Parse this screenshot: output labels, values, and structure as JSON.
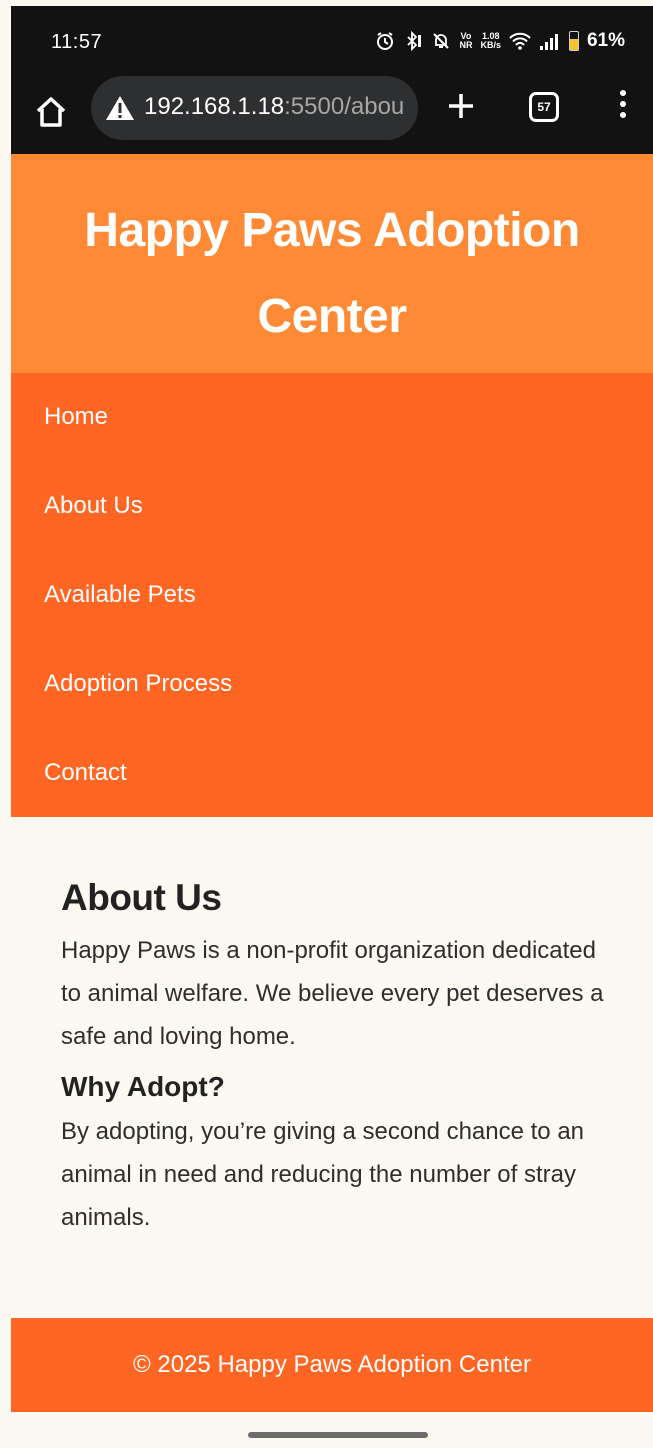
{
  "status_bar": {
    "time": "11:57",
    "network_speed_value": "1.08",
    "network_speed_unit": "KB/s",
    "network_type_top": "Vo",
    "network_type_bottom": "NR",
    "battery_percent": "61%",
    "battery_level": 0.61,
    "icons": [
      "alarm-icon",
      "bluetooth-icon",
      "mute-icon",
      "volte-icon",
      "wifi-icon",
      "signal-icon",
      "battery-icon"
    ]
  },
  "browser": {
    "url_host": "192.168.1.18",
    "url_rest": ":5500/abou",
    "tab_count": "57",
    "icons": [
      "home-icon",
      "not-secure-warning-icon",
      "new-tab-plus-icon",
      "tab-switcher-icon",
      "overflow-menu-icon"
    ]
  },
  "header": {
    "title": "Happy Paws Adoption Center"
  },
  "nav": {
    "items": [
      {
        "label": "Home"
      },
      {
        "label": "About Us"
      },
      {
        "label": "Available Pets"
      },
      {
        "label": "Adoption Process"
      },
      {
        "label": "Contact"
      }
    ]
  },
  "main": {
    "about_heading": "About Us",
    "about_text": "Happy Paws is a non-profit organization dedicated to animal welfare. We believe every pet deserves a safe and loving home.",
    "why_heading": "Why Adopt?",
    "why_text": "By adopting, you’re giving a second chance to an animal in need and reducing the number of stray animals."
  },
  "footer": {
    "text": "© 2025 Happy Paws Adoption Center"
  },
  "colors": {
    "header_bg": "#ff8a35",
    "nav_bg": "#ff6523",
    "footer_bg": "#ff6523",
    "page_bg": "#fcf9f3",
    "browser_bg": "#121212"
  }
}
